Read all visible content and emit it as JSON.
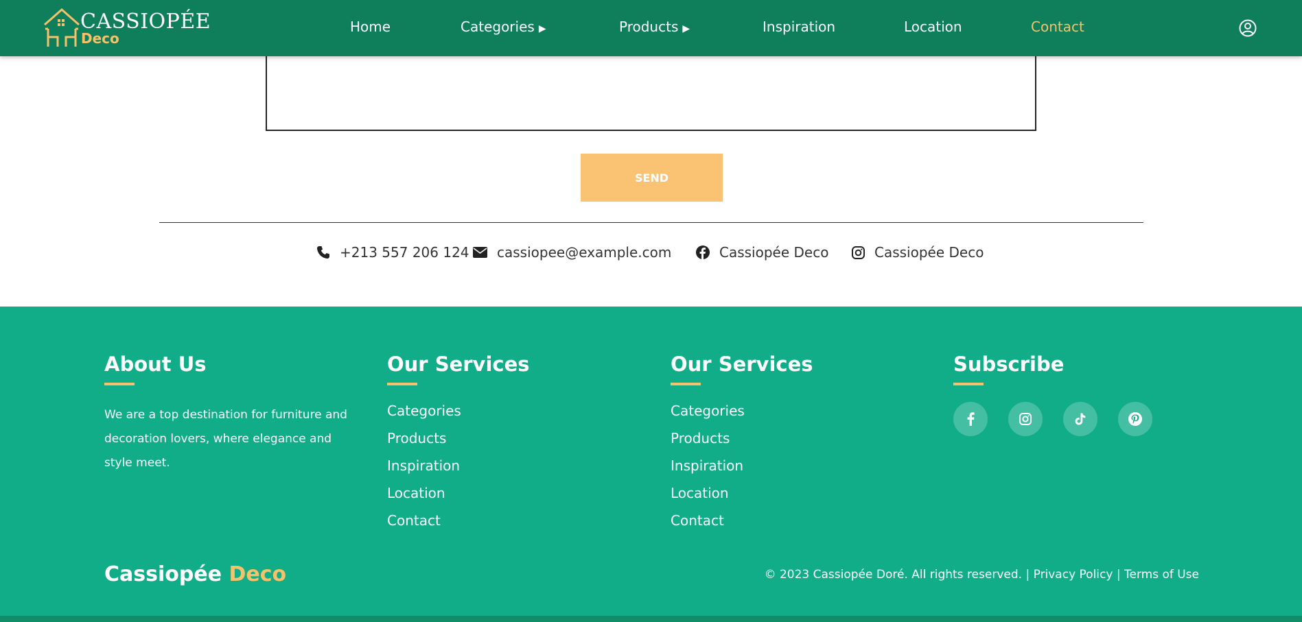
{
  "nav": {
    "logo_word1": "CASSIOPÉE",
    "logo_word2": "Deco",
    "links": [
      {
        "label": "Home"
      },
      {
        "label": "Categories",
        "arrow": "▶"
      },
      {
        "label": "Products",
        "arrow": "▶"
      },
      {
        "label": "Inspiration"
      },
      {
        "label": "Location"
      },
      {
        "label": "Contact"
      }
    ],
    "active": "Contact",
    "user_icon": "user-circle-icon"
  },
  "form": {
    "message_value": "",
    "send_label": "SEND"
  },
  "contact": {
    "phone": "+213 557 206 124",
    "email": "cassiopee@example.com",
    "facebook": "Cassiopée Deco",
    "instagram": "Cassiopée Deco"
  },
  "footer": {
    "about": {
      "title": "About Us",
      "text": "We are a top destination for furniture and decoration lovers, where elegance and style meet."
    },
    "services1": {
      "title": "Our Services",
      "items": [
        "Categories",
        "Products",
        "Inspiration",
        "Location",
        "Contact"
      ]
    },
    "services2": {
      "title": "Our Services",
      "items": [
        "Categories",
        "Products",
        "Inspiration",
        "Location",
        "Contact"
      ]
    },
    "subscribe": {
      "title": "Subscribe",
      "socials": [
        "facebook-icon",
        "instagram-icon",
        "tiktok-icon",
        "pinterest-icon"
      ]
    },
    "brand_name": "Cassiopée",
    "brand_accent": "Deco",
    "copyright": "© 2023 Cassiopée Doré. All rights reserved. |",
    "privacy": "Privacy Policy",
    "separator": "|",
    "terms": "Terms of Use"
  },
  "colors": {
    "nav_bg": "#0e7f5a",
    "footer_bg": "#11ad89",
    "accent": "#f5c26b",
    "send_bg": "#f9c373"
  }
}
